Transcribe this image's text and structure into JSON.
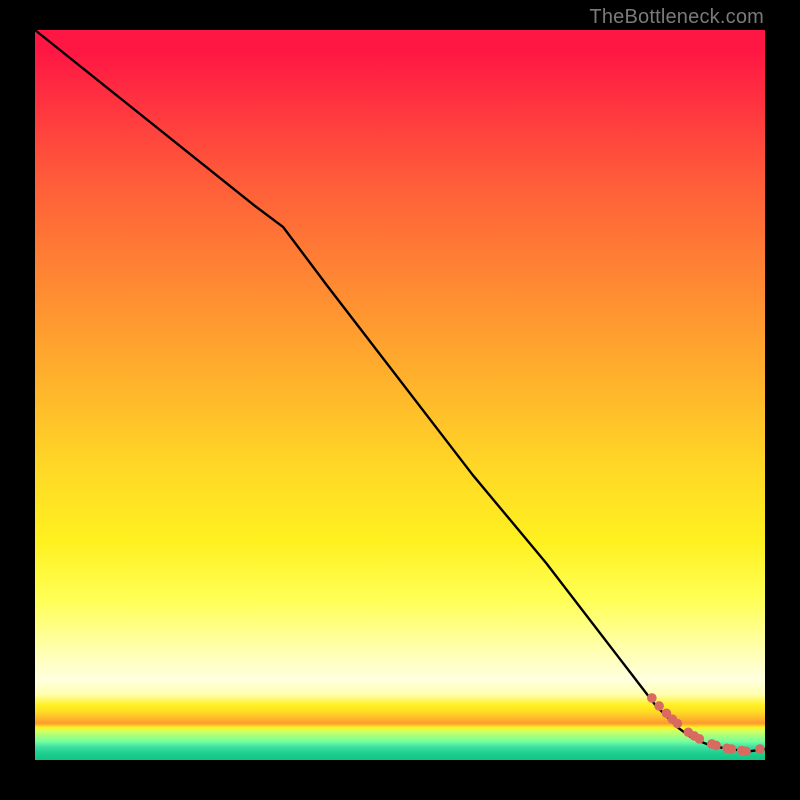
{
  "watermark": "TheBottleneck.com",
  "chart_data": {
    "type": "line",
    "title": "",
    "xlabel": "",
    "ylabel": "",
    "xlim": [
      0,
      100
    ],
    "ylim": [
      0,
      100
    ],
    "grid": false,
    "curve": {
      "x": [
        0,
        10,
        20,
        30,
        34,
        40,
        50,
        60,
        70,
        80,
        85,
        88,
        90,
        92,
        94,
        96,
        98,
        100
      ],
      "y": [
        100,
        92,
        84,
        76,
        73,
        65,
        52,
        39,
        27,
        14,
        7.5,
        4.5,
        3.0,
        2.2,
        1.7,
        1.4,
        1.2,
        1.5
      ]
    },
    "scatter": {
      "x": [
        84.5,
        85.5,
        86.5,
        87.3,
        88.0,
        89.5,
        90.3,
        91.0,
        92.7,
        93.3,
        94.8,
        95.4,
        96.8,
        97.4,
        99.3
      ],
      "y": [
        8.5,
        7.4,
        6.4,
        5.6,
        5.0,
        3.8,
        3.3,
        2.9,
        2.2,
        2.0,
        1.6,
        1.5,
        1.3,
        1.2,
        1.5
      ]
    },
    "scatter_color": "#d96a61",
    "curve_color": "#000000"
  }
}
